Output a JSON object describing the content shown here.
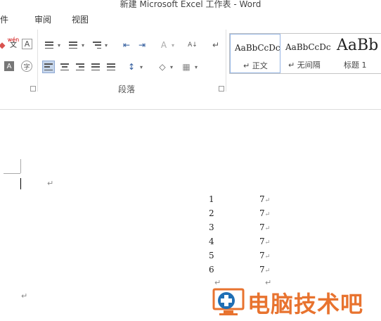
{
  "window": {
    "title": "新建 Microsoft Excel 工作表 - Word"
  },
  "tabs": [
    {
      "label": "邮件"
    },
    {
      "label": "审阅"
    },
    {
      "label": "视图"
    }
  ],
  "font_group": {
    "phonetic_guide_top": "wén",
    "phonetic_guide_bottom": "文",
    "char_border": "A",
    "enclose_char": "字"
  },
  "paragraph_group": {
    "label": "段落"
  },
  "styles": [
    {
      "sample": "AaBbCcDc",
      "name": "正文"
    },
    {
      "sample": "AaBbCcDc",
      "name": "无间隔"
    },
    {
      "sample": "AaBb",
      "name": "标题 1"
    }
  ],
  "document": {
    "table": [
      {
        "n": "1",
        "v": "7"
      },
      {
        "n": "2",
        "v": "7"
      },
      {
        "n": "3",
        "v": "7"
      },
      {
        "n": "4",
        "v": "7"
      },
      {
        "n": "5",
        "v": "7"
      },
      {
        "n": "6",
        "v": "7"
      }
    ]
  },
  "watermark": {
    "text": "电脑技术吧",
    "color": "#e8732f"
  },
  "colors": {
    "accent": "#2b579a",
    "active_button": "#c5d5ea"
  }
}
